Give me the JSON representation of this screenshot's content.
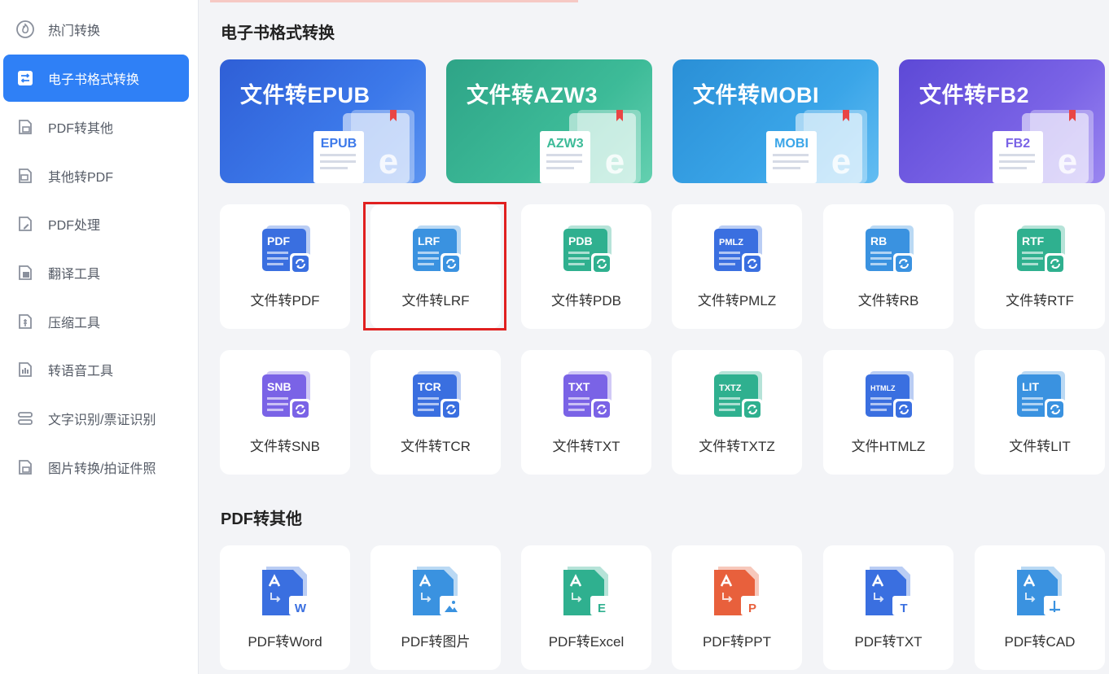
{
  "sidebar": {
    "items": [
      {
        "label": "热门转换",
        "icon": "fire-icon"
      },
      {
        "label": "电子书格式转换",
        "icon": "ebook-convert-icon",
        "active": true
      },
      {
        "label": "PDF转其他",
        "icon": "pdf-out-icon"
      },
      {
        "label": "其他转PDF",
        "icon": "pdf-in-icon"
      },
      {
        "label": "PDF处理",
        "icon": "pdf-edit-icon"
      },
      {
        "label": "翻译工具",
        "icon": "translate-icon"
      },
      {
        "label": "压缩工具",
        "icon": "compress-icon"
      },
      {
        "label": "转语音工具",
        "icon": "voice-icon"
      },
      {
        "label": "文字识别/票证识别",
        "icon": "ocr-icon"
      },
      {
        "label": "图片转换/拍证件照",
        "icon": "image-convert-icon"
      }
    ]
  },
  "ebook_section": {
    "title": "电子书格式转换",
    "banners": [
      {
        "title": "文件转EPUB",
        "badge": "EPUB",
        "color": "#3c79ea"
      },
      {
        "title": "文件转AZW3",
        "badge": "AZW3",
        "color": "#3dbb98"
      },
      {
        "title": "文件转MOBI",
        "badge": "MOBI",
        "color": "#3aa5e8"
      },
      {
        "title": "文件转FB2",
        "badge": "FB2",
        "color": "#7a63e6"
      }
    ],
    "tools": [
      {
        "label": "文件转PDF",
        "badge": "PDF",
        "color": "#3a6fe0"
      },
      {
        "label": "文件转LRF",
        "badge": "LRF",
        "color": "#3a92e0",
        "highlighted": true
      },
      {
        "label": "文件转PDB",
        "badge": "PDB",
        "color": "#2fb08f"
      },
      {
        "label": "文件转PMLZ",
        "badge": "PMLZ",
        "color": "#3a6fe0"
      },
      {
        "label": "文件转RB",
        "badge": "RB",
        "color": "#3a92e0"
      },
      {
        "label": "文件转RTF",
        "badge": "RTF",
        "color": "#2fb08f"
      },
      {
        "label": "文件转SNB",
        "badge": "SNB",
        "color": "#7a63e6"
      },
      {
        "label": "文件转TCR",
        "badge": "TCR",
        "color": "#3a6fe0"
      },
      {
        "label": "文件转TXT",
        "badge": "TXT",
        "color": "#7a63e6"
      },
      {
        "label": "文件转TXTZ",
        "badge": "TXTZ",
        "color": "#2fb08f"
      },
      {
        "label": "文件HTMLZ",
        "badge": "HTMLZ",
        "color": "#3a6fe0"
      },
      {
        "label": "文件转LIT",
        "badge": "LIT",
        "color": "#3a92e0"
      }
    ]
  },
  "pdf_section": {
    "title": "PDF转其他",
    "tools": [
      {
        "label": "PDF转Word",
        "badge": "W",
        "color": "#3a6fe0"
      },
      {
        "label": "PDF转图片",
        "badge": "img",
        "color": "#3a92e0"
      },
      {
        "label": "PDF转Excel",
        "badge": "E",
        "color": "#2fb08f"
      },
      {
        "label": "PDF转PPT",
        "badge": "P",
        "color": "#e8603c"
      },
      {
        "label": "PDF转TXT",
        "badge": "T",
        "color": "#3a6fe0"
      },
      {
        "label": "PDF转CAD",
        "badge": "cad",
        "color": "#3a92e0"
      }
    ]
  }
}
